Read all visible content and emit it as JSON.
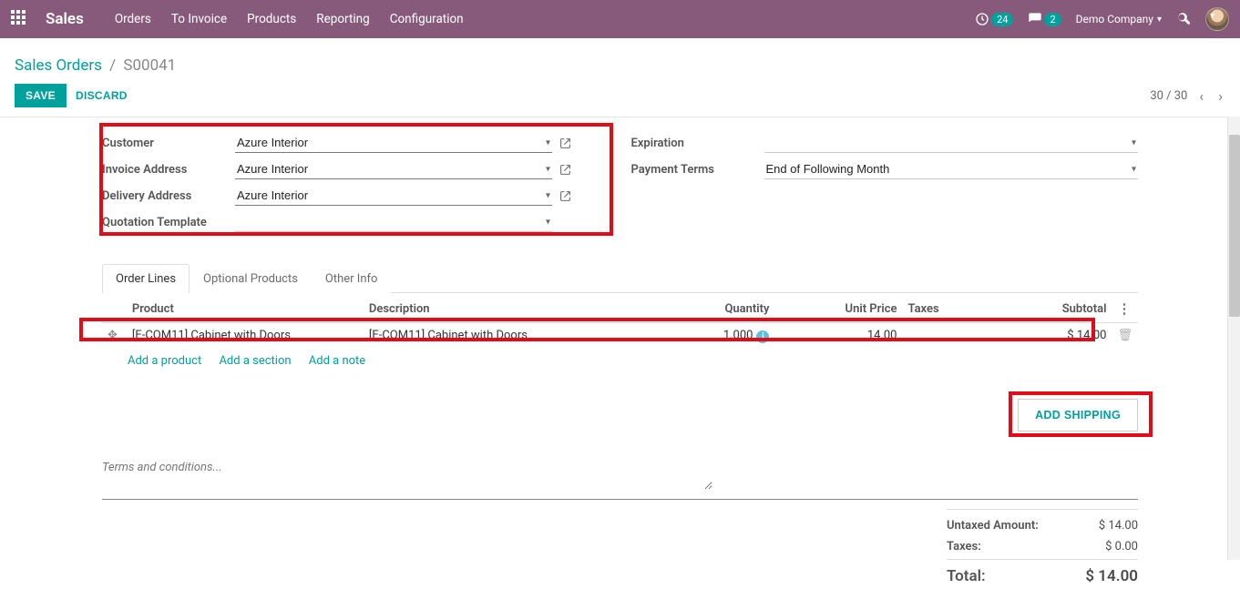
{
  "topbar": {
    "app_title": "Sales",
    "menu": [
      "Orders",
      "To Invoice",
      "Products",
      "Reporting",
      "Configuration"
    ],
    "clock_badge": "24",
    "chat_badge": "2",
    "company": "Demo Company"
  },
  "breadcrumb": {
    "root": "Sales Orders",
    "leaf": "S00041"
  },
  "actions": {
    "save": "Save",
    "discard": "Discard"
  },
  "pager": {
    "text": "30 / 30"
  },
  "form": {
    "left": {
      "customer": {
        "label": "Customer",
        "value": "Azure Interior"
      },
      "invoice_address": {
        "label": "Invoice Address",
        "value": "Azure Interior"
      },
      "delivery_address": {
        "label": "Delivery Address",
        "value": "Azure Interior"
      },
      "quotation_template": {
        "label": "Quotation Template",
        "value": ""
      }
    },
    "right": {
      "expiration": {
        "label": "Expiration",
        "value": ""
      },
      "payment_terms": {
        "label": "Payment Terms",
        "value": "End of Following Month"
      }
    }
  },
  "tabs": [
    "Order Lines",
    "Optional Products",
    "Other Info"
  ],
  "active_tab": 0,
  "columns": {
    "product": "Product",
    "description": "Description",
    "quantity": "Quantity",
    "unit_price": "Unit Price",
    "taxes": "Taxes",
    "subtotal": "Subtotal"
  },
  "lines": [
    {
      "product": "[E-COM11] Cabinet with Doors",
      "description": "[E-COM11] Cabinet with Doors",
      "quantity": "1.000",
      "unit_price": "14.00",
      "taxes": "",
      "subtotal": "$ 14.00"
    }
  ],
  "add_links": {
    "product": "Add a product",
    "section": "Add a section",
    "note": "Add a note"
  },
  "terms_placeholder": "Terms and conditions...",
  "add_shipping": "Add Shipping",
  "totals": {
    "untaxed_label": "Untaxed Amount:",
    "untaxed_value": "$ 14.00",
    "taxes_label": "Taxes:",
    "taxes_value": "$ 0.00",
    "total_label": "Total:",
    "total_value": "$ 14.00"
  }
}
